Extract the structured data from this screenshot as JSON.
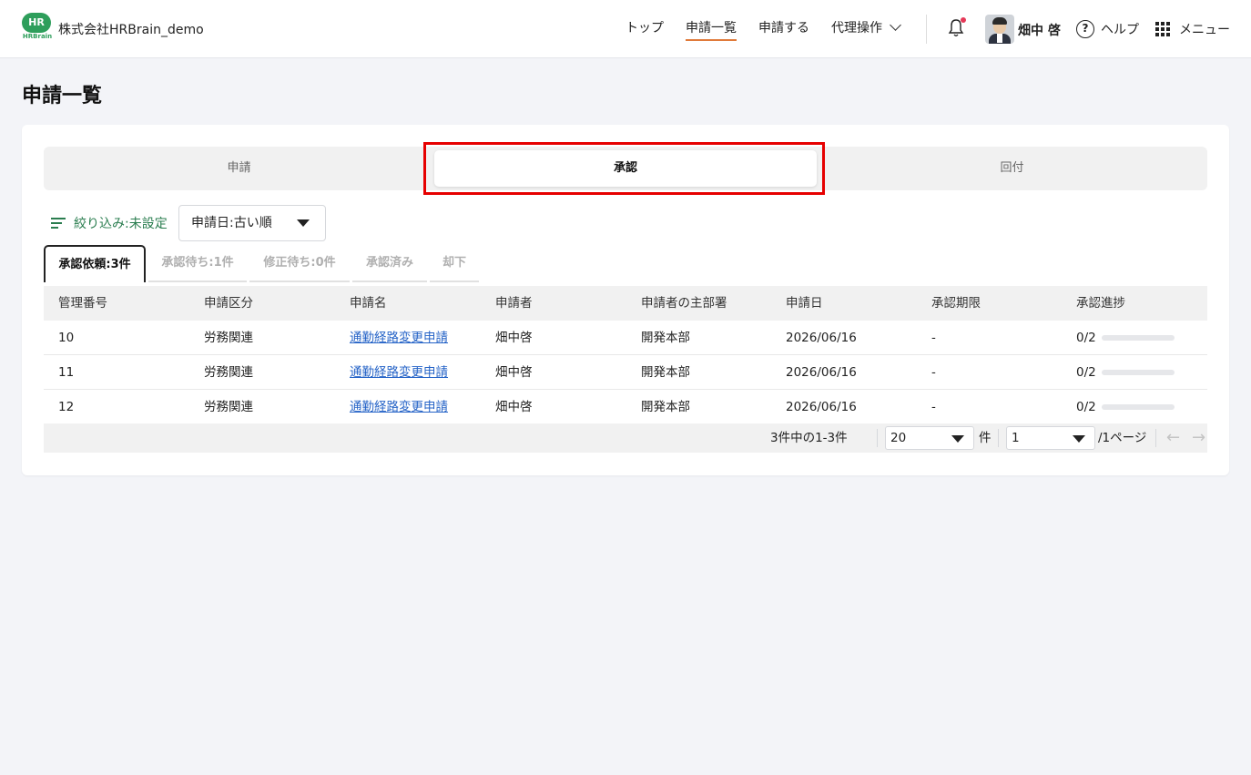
{
  "header": {
    "logo_text": "HR",
    "logo_sub": "HRBrain",
    "company": "株式会社HRBrain_demo",
    "nav": [
      {
        "label": "トップ"
      },
      {
        "label": "申請一覧"
      },
      {
        "label": "申請する"
      },
      {
        "label": "代理操作"
      }
    ],
    "user_name": "畑中 啓",
    "help_label": "ヘルプ",
    "menu_label": "メニュー"
  },
  "page": {
    "title": "申請一覧"
  },
  "segments": [
    {
      "label": "申請"
    },
    {
      "label": "承認"
    },
    {
      "label": "回付"
    }
  ],
  "filter": {
    "label": "絞り込み:未設定"
  },
  "sort": {
    "value": "申請日:古い順"
  },
  "subtabs": [
    {
      "label": "承認依頼:3件"
    },
    {
      "label": "承認待ち:1件"
    },
    {
      "label": "修正待ち:0件"
    },
    {
      "label": "承認済み"
    },
    {
      "label": "却下"
    }
  ],
  "table": {
    "columns": [
      "管理番号",
      "申請区分",
      "申請名",
      "申請者",
      "申請者の主部署",
      "申請日",
      "承認期限",
      "承認進捗"
    ],
    "rows": [
      {
        "id": "10",
        "category": "労務関連",
        "name": "通勤経路変更申請",
        "applicant": "畑中啓",
        "dept": "開発本部",
        "date": "2026/06/16",
        "deadline": "-",
        "progress": "0/2",
        "progress_fraction": 0
      },
      {
        "id": "11",
        "category": "労務関連",
        "name": "通勤経路変更申請",
        "applicant": "畑中啓",
        "dept": "開発本部",
        "date": "2026/06/16",
        "deadline": "-",
        "progress": "0/2",
        "progress_fraction": 0
      },
      {
        "id": "12",
        "category": "労務関連",
        "name": "通勤経路変更申請",
        "applicant": "畑中啓",
        "dept": "開発本部",
        "date": "2026/06/16",
        "deadline": "-",
        "progress": "0/2",
        "progress_fraction": 0
      }
    ]
  },
  "pager": {
    "count": "3件中の1-3件",
    "per_page": "20",
    "per_page_unit": "件",
    "page": "1",
    "page_total": "/1ページ"
  },
  "colors": {
    "accent": "#2e9e5b",
    "nav_underline": "#e07a3a",
    "link": "#2563c7",
    "highlight": "#e60000",
    "notification": "#e53958"
  }
}
